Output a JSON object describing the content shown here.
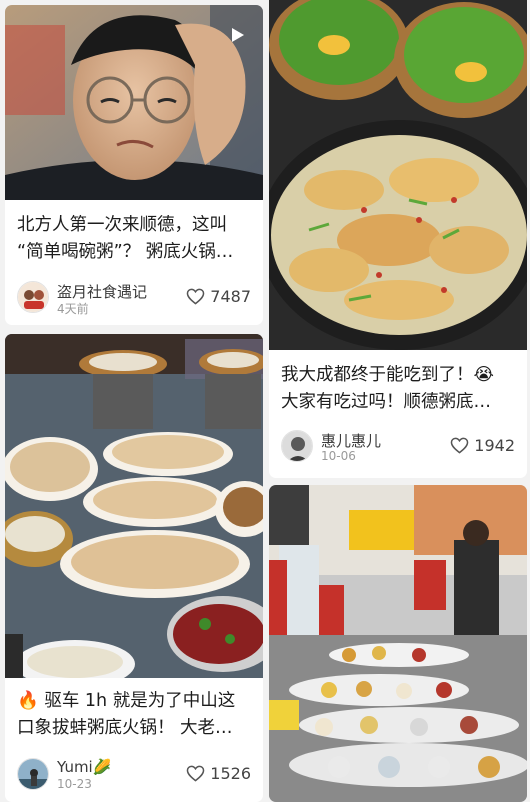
{
  "cards": [
    {
      "title_lines": [
        "北方人第一次来顺德，这叫",
        "“简单喝碗粥”？ 粥底火锅…"
      ],
      "author": "盗月社食遇记",
      "date": "4天前",
      "likes": "7487",
      "is_video": true
    },
    {
      "title_lines": [
        "我大成都终于能吃到了！😭",
        "大家有吃过吗！顺德粥底…"
      ],
      "author": "惠儿惠儿",
      "date": "10-06",
      "likes": "1942"
    },
    {
      "title_lines": [
        "🔥 驱车 1h 就是为了中山这",
        "口象拔蚌粥底火锅！ 大老…"
      ],
      "author": "Yumi🌽",
      "date": "10-23",
      "likes": "1526"
    },
    {
      "title_lines": [],
      "author": "",
      "date": "",
      "likes": ""
    }
  ],
  "colors": {
    "background": "#f2f2f2",
    "card": "#ffffff",
    "heart_outline": "#555555"
  },
  "icons": {
    "video": "play-icon",
    "like": "heart-outline-icon"
  }
}
